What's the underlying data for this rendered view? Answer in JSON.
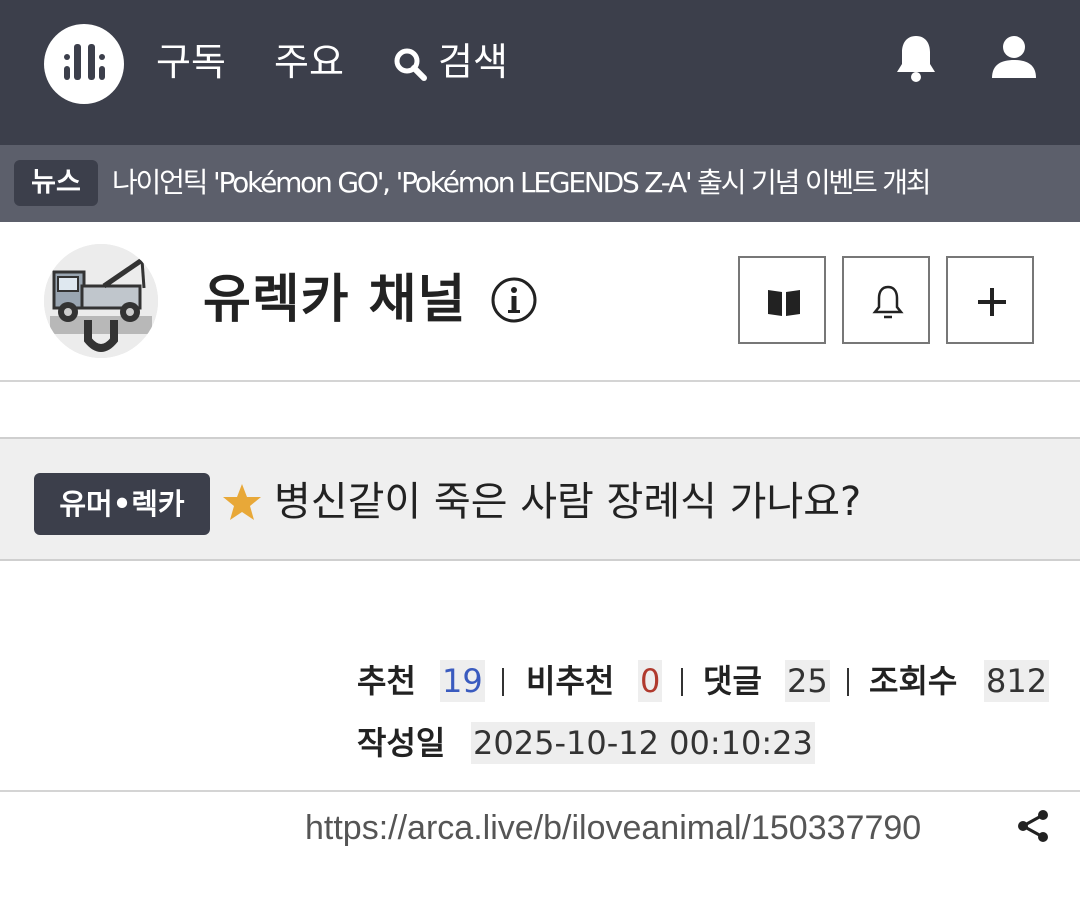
{
  "nav": {
    "items": [
      {
        "label": "구독"
      },
      {
        "label": "주요"
      },
      {
        "label": "검색"
      }
    ],
    "icons": [
      "logo-icon",
      "search-icon",
      "bell-icon",
      "user-icon"
    ]
  },
  "news": {
    "badge": "뉴스",
    "headline": "나이언틱 'Pokémon GO', 'Pokémon LEGENDS Z-A' 출시 기념 이벤트 개최"
  },
  "channel": {
    "title": "유렉카 채널",
    "buttons": [
      "book-icon",
      "bell-outline-icon",
      "plus-icon"
    ]
  },
  "article": {
    "category": "유머•렉카",
    "title": "병신같이 죽은 사람 장례식 가나요?",
    "stats": {
      "recommend_label": "추천",
      "recommend": "19",
      "downvote_label": "비추천",
      "downvote": "0",
      "comments_label": "댓글",
      "comments": "25",
      "views_label": "조회수",
      "views": "812",
      "date_label": "작성일",
      "date": "2025-10-12 00:10:23"
    },
    "url": "https://arca.live/b/iloveanimal/150337790"
  },
  "colors": {
    "nav_bg": "#3c3f4b",
    "news_bg": "#5c5f6b",
    "recommend": "#3a5bbf",
    "downvote": "#b03a2e",
    "star": "#e8a838"
  }
}
